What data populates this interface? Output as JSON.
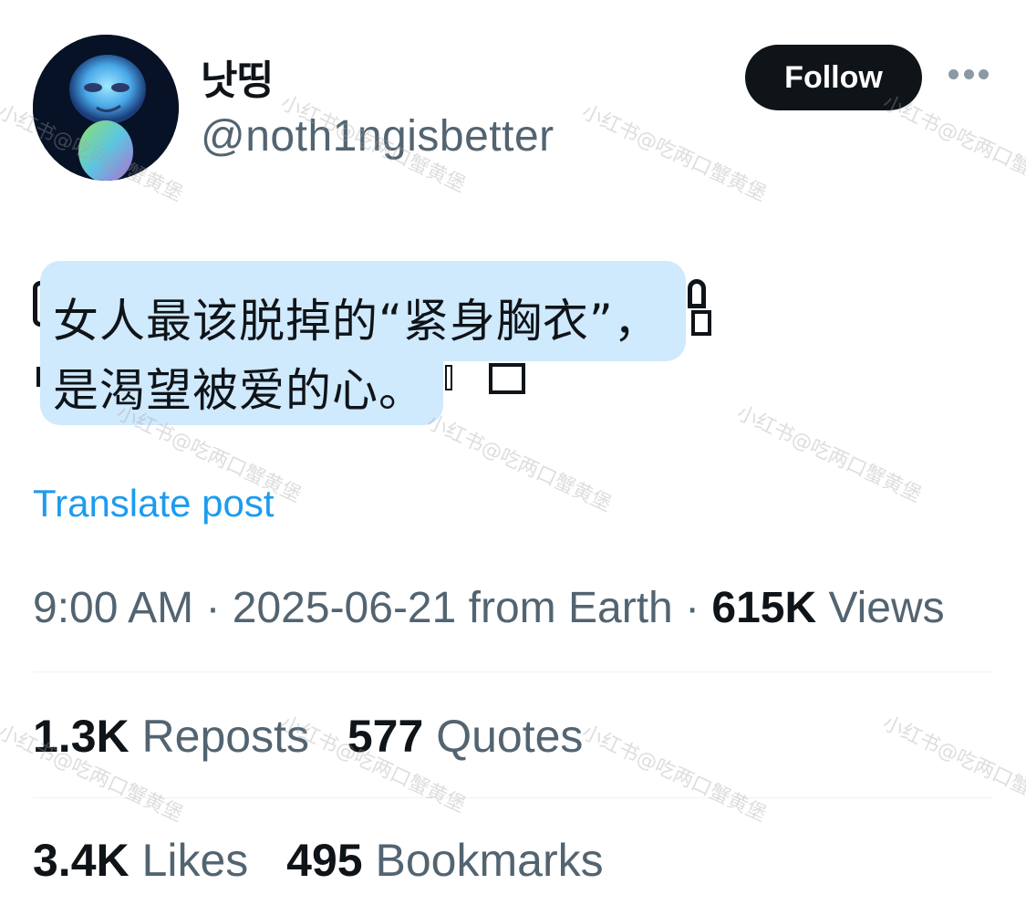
{
  "header": {
    "display_name": "낫띵",
    "handle": "@noth1ngisbetter",
    "follow_label": "Follow"
  },
  "caption": {
    "line1": "女人最该脱掉的“紧身胸衣”，",
    "line2": "是渴望被爱的心。"
  },
  "translate_label": "Translate post",
  "meta": {
    "time": "9:00 AM",
    "date": "2025-06-21",
    "location": "from Earth",
    "views_count": "615K",
    "views_label": "Views"
  },
  "stats": {
    "reposts_count": "1.3K",
    "reposts_label": "Reposts",
    "quotes_count": "577",
    "quotes_label": "Quotes",
    "likes_count": "3.4K",
    "likes_label": "Likes",
    "bookmarks_count": "495",
    "bookmarks_label": "Bookmarks"
  },
  "watermark_text": "小红书@吃两口蟹黄堡",
  "icons": {
    "more": "more-horizontal-icon"
  },
  "colors": {
    "accent": "#1d9bf0",
    "text_primary": "#0f1419",
    "text_secondary": "#536471",
    "caption_bg": "#cfe9fd"
  }
}
